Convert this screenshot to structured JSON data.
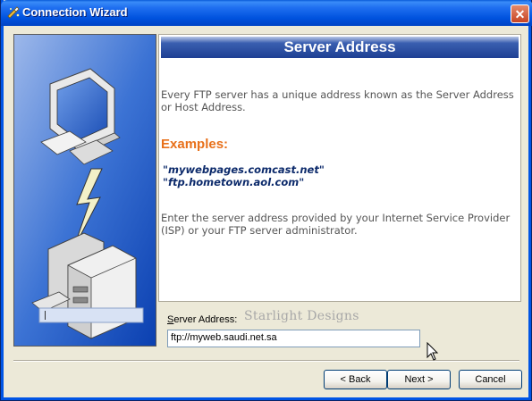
{
  "window": {
    "title": "Connection Wizard",
    "close_glyph": "✕"
  },
  "header": {
    "title": "Server Address"
  },
  "content": {
    "intro": "Every FTP server has a unique address known as the Server Address or Host Address.",
    "examples_title": "Examples:",
    "examples": [
      "\"mywebpages.comcast.net\"",
      "\"ftp.hometown.aol.com\""
    ],
    "instructions": "Enter the server address provided by your Internet Service Provider (ISP) or your FTP server administrator."
  },
  "server_field": {
    "label_prefix": "S",
    "label_rest": "erver Address:",
    "value": "ftp://myweb.saudi.net.sa"
  },
  "watermark": "Starlight Designs",
  "buttons": {
    "back": "< Back",
    "next": "Next >",
    "cancel": "Cancel"
  },
  "icons": {
    "title": "wizard-icon",
    "close": "close-icon",
    "illustration": "network-computers-illustration",
    "cursor": "mouse-pointer-icon"
  },
  "colors": {
    "titlebar": "#0052de",
    "header_bar": "#1e3f93",
    "examples_title": "#e8701a",
    "example_text": "#0c2a6b",
    "left_panel": "#1c5ac8"
  }
}
